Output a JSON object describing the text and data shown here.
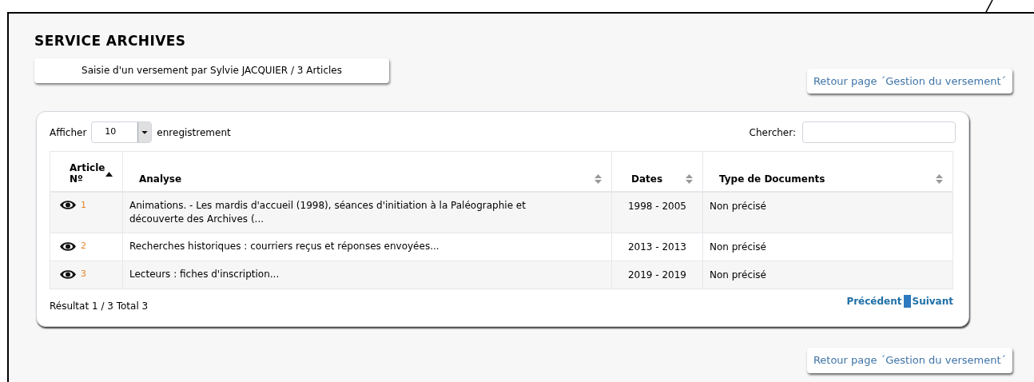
{
  "title": "SERVICE ARCHIVES",
  "summary": "Saisie d'un versement par Sylvie JACQUIER / 3 Articles",
  "back_links": [
    "Retour page ´Gestion du versement´",
    "Retour page ´Gestion du versement´"
  ],
  "length_control": {
    "label": "Afficher",
    "value": "10",
    "suffix": "enregistrement"
  },
  "search": {
    "label": "Chercher:"
  },
  "table": {
    "columns": [
      {
        "lines": [
          "Article",
          "Nº"
        ],
        "sorted": true
      },
      {
        "lines": [
          "Analyse"
        ],
        "sorted": false
      },
      {
        "lines": [
          "Dates"
        ],
        "sorted": false
      },
      {
        "lines": [
          "Type de Documents"
        ],
        "sorted": false
      }
    ],
    "rows": [
      {
        "number": "1",
        "analyse": "Animations. - Les mardis d'accueil (1998), séances d'initiation à la Paléographie et découverte des Archives (...",
        "dates": "1998 - 2005",
        "type": "Non précisé"
      },
      {
        "number": "2",
        "analyse": "Recherches historiques : courriers reçus et réponses envoyées...",
        "dates": "2013 - 2013",
        "type": "Non précisé"
      },
      {
        "number": "3",
        "analyse": "Lecteurs : fiches d'inscription...",
        "dates": "2019 - 2019",
        "type": "Non précisé"
      }
    ]
  },
  "result": "Résultat 1 / 3 Total 3",
  "pagination": {
    "previous": "Précédent",
    "next": "Suivant"
  }
}
